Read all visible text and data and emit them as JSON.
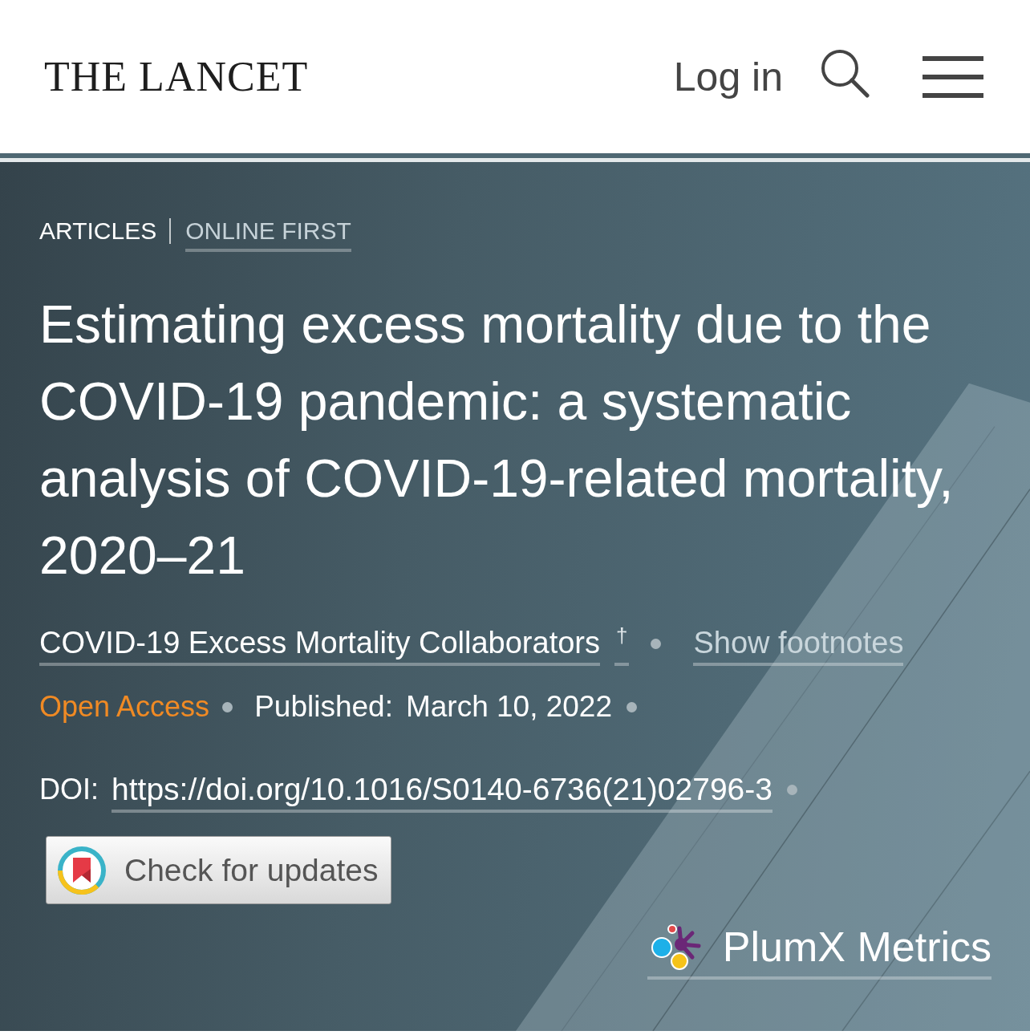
{
  "header": {
    "logo": "THE LANCET",
    "login": "Log in"
  },
  "article": {
    "breadcrumb": [
      {
        "kind": "section",
        "label": "ARTICLES"
      },
      {
        "kind": "link",
        "label": "ONLINE FIRST"
      }
    ],
    "title": "Estimating excess mortality due to the COVID-19 pandemic: a systematic analysis of COVID-19-related mortality, 2020–21",
    "authors": {
      "name": "COVID-19 Excess Mortality Collaborators",
      "footnote_mark": "†",
      "footnotes_toggle": "Show footnotes"
    },
    "meta": {
      "access": "Open Access",
      "published_label": "Published:",
      "published_date": "March 10, 2022"
    },
    "doi": {
      "label": "DOI:",
      "link": "https://doi.org/10.1016/S0140-6736(21)02796-3"
    },
    "check_updates": {
      "label": "Check for updates"
    },
    "metrics": {
      "label": "PlumX Metrics"
    }
  }
}
